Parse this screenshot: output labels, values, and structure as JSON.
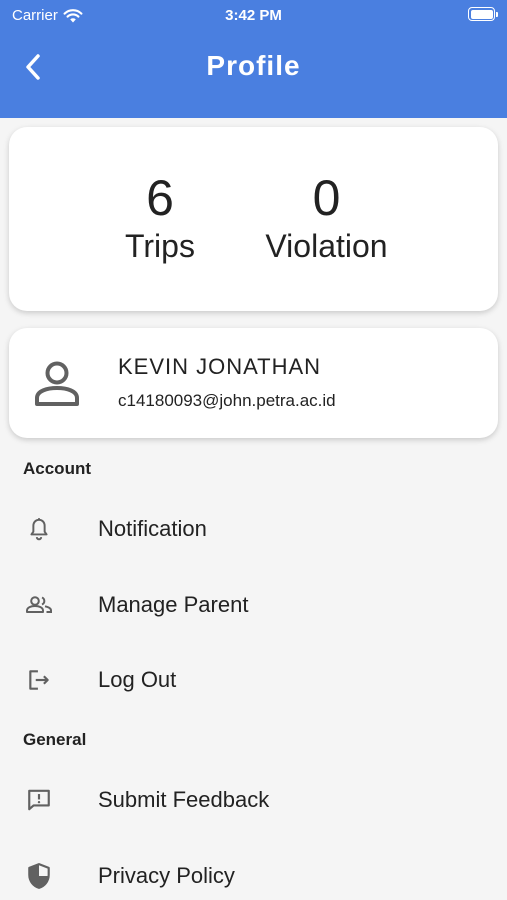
{
  "status_bar": {
    "carrier": "Carrier",
    "time": "3:42 PM"
  },
  "header": {
    "title": "Profile"
  },
  "stats": {
    "trips_value": "6",
    "trips_label": "Trips",
    "violation_value": "0",
    "violation_label": "Violation"
  },
  "user": {
    "name": "KEVIN JONATHAN",
    "email": "c14180093@john.petra.ac.id"
  },
  "sections": {
    "account": {
      "title": "Account",
      "items": [
        {
          "label": "Notification",
          "icon": "bell-icon"
        },
        {
          "label": "Manage Parent",
          "icon": "people-icon"
        },
        {
          "label": "Log Out",
          "icon": "logout-icon"
        }
      ]
    },
    "general": {
      "title": "General",
      "items": [
        {
          "label": "Submit Feedback",
          "icon": "feedback-icon"
        },
        {
          "label": "Privacy Policy",
          "icon": "shield-icon"
        }
      ]
    }
  },
  "colors": {
    "header_bg": "#4a7fe0",
    "page_bg": "#f5f5f5",
    "icon_gray": "#616161"
  }
}
